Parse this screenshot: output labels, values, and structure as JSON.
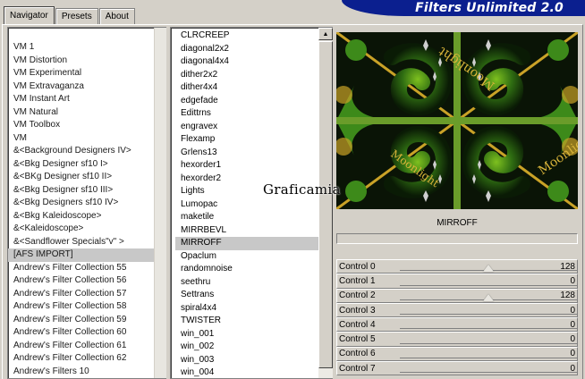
{
  "tabs": [
    "Navigator",
    "Presets",
    "About"
  ],
  "brand": "Filters Unlimited 2.0",
  "categories": [
    "VM 1",
    "VM Distortion",
    "VM Experimental",
    "VM Extravaganza",
    "VM Instant Art",
    "VM Natural",
    "VM Toolbox",
    "VM",
    "&<Background Designers IV>",
    "&<Bkg Designer sf10 I>",
    "&<BKg Designer sf10 II>",
    "&<Bkg Designer sf10 III>",
    "&<Bkg Designers sf10 IV>",
    "&<Bkg Kaleidoscope>",
    "&<Kaleidoscope>",
    "&<Sandflower Specials\"v\" >",
    "[AFS IMPORT]",
    "Andrew's Filter Collection 55",
    "Andrew's Filter Collection 56",
    "Andrew's Filter Collection 57",
    "Andrew's Filter Collection 58",
    "Andrew's Filter Collection 59",
    "Andrew's Filter Collection 60",
    "Andrew's Filter Collection 61",
    "Andrew's Filter Collection 62",
    "Andrew's Filters 10"
  ],
  "selected_category": "[AFS IMPORT]",
  "filters": [
    "CLRCREEP",
    "diagonal2x2",
    "diagonal4x4",
    "dither2x2",
    "dither4x4",
    "edgefade",
    "Edittrns",
    "engravex",
    "Flexamp",
    "Grlens13",
    "hexorder1",
    "hexorder2",
    "Lights",
    "Lumopac",
    "maketile",
    "MIRRBEVL",
    "MIRROFF",
    "Opaclum",
    "randomnoise",
    "seethru",
    "Settrans",
    "spiral4x4",
    "TWISTER",
    "win_001",
    "win_002",
    "win_003",
    "win_004"
  ],
  "selected_filter": "MIRROFF",
  "preview_text": "Moonlight",
  "watermark": "Graficamia",
  "current_filter": "MIRROFF",
  "controls": [
    {
      "label": "Control 0",
      "value": "128",
      "level": 0.5
    },
    {
      "label": "Control 1",
      "value": "0",
      "level": null
    },
    {
      "label": "Control 2",
      "value": "128",
      "level": 0.5
    },
    {
      "label": "Control 3",
      "value": "0",
      "level": null
    },
    {
      "label": "Control 4",
      "value": "0",
      "level": null
    },
    {
      "label": "Control 5",
      "value": "0",
      "level": null
    },
    {
      "label": "Control 6",
      "value": "0",
      "level": null
    },
    {
      "label": "Control 7",
      "value": "0",
      "level": null
    }
  ],
  "colors": {
    "banner": "#0b1f8f",
    "window": "#d4d0c8",
    "selection": "#c8c8c8",
    "preview_gold": "#c9a227",
    "preview_green": "#3d8a1a"
  },
  "icons": {
    "scroll_up": "▲",
    "scroll_down": "▼"
  }
}
